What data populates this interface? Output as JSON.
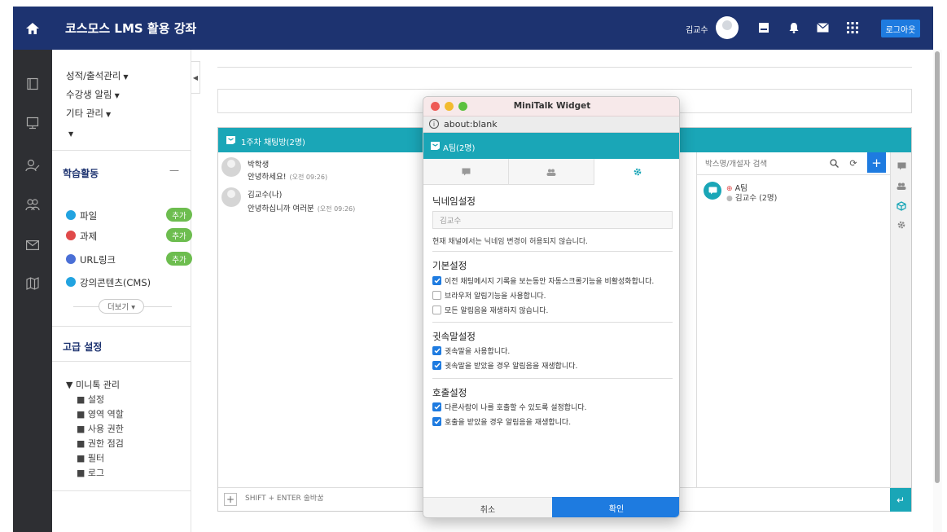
{
  "topbar": {
    "site_title": "코스모스 LMS 활용 강좌",
    "user_name": "김교수",
    "logout_label": "로그아웃"
  },
  "sidebar": {
    "menu_links": [
      {
        "label": "성적/출석관리"
      },
      {
        "label": "수강생 알림"
      },
      {
        "label": "기타 관리"
      }
    ],
    "activity_title": "학습활동",
    "collapse_symbol": "—",
    "activities": [
      {
        "label": "파일",
        "badge": "추가",
        "color": "#22a3e0"
      },
      {
        "label": "과제",
        "badge": "추가",
        "color": "#e04a4a"
      },
      {
        "label": "URL링크",
        "badge": "추가",
        "color": "#4a6fd6"
      },
      {
        "label": "강의콘텐츠(CMS)",
        "color": "#22a3e0"
      }
    ],
    "more_label": "더보기 ▾",
    "advanced_title": "고급 설정",
    "tree_root": "▼ 미니톡 관리",
    "tree_items": [
      "■ 설정",
      "■ 영역 역할",
      "■ 사용 권한",
      "■ 권한 점검",
      "■ 필터",
      "■ 로그"
    ]
  },
  "chat": {
    "title": "1주차 채팅방(2명)",
    "messages": [
      {
        "name": "박학생",
        "text": "안녕하세요!",
        "time": "(오전 09:26)"
      },
      {
        "name": "김교수(나)",
        "text": "안녕하십니까 여러분",
        "time": "(오전 09:26)"
      }
    ],
    "input_placeholder": "SHIFT + ENTER 줄바꿈",
    "search_placeholder": "박스명/개설자 검색",
    "room_name": "A팀",
    "room_owner": "김교수 (2명)"
  },
  "widget": {
    "window_title": "MiniTalk Widget",
    "url": "about:blank",
    "header_title": "A팀(2명)",
    "nickname_title": "닉네임설정",
    "nickname_value": "김교수",
    "nickname_note": "현재 채널에서는 닉네임 변경이 허용되지 않습니다.",
    "basic_title": "기본설정",
    "basic_options": [
      {
        "label": "이전 채팅메시지 기록을 보는동안 자동스크롤기능을 비활성화합니다.",
        "checked": true
      },
      {
        "label": "브라우저 알림기능을 사용합니다.",
        "checked": false
      },
      {
        "label": "모든 알림음을 재생하지 않습니다.",
        "checked": false
      }
    ],
    "whisper_title": "귓속말설정",
    "whisper_options": [
      {
        "label": "귓속말을 사용합니다.",
        "checked": true
      },
      {
        "label": "귓속말을 받았을 경우 알림음을 재생합니다.",
        "checked": true
      }
    ],
    "call_title": "호출설정",
    "call_options": [
      {
        "label": "다른사람이 나를 호출할 수 있도록 설정합니다.",
        "checked": true
      },
      {
        "label": "호출을 받았을 경우 알림음을 재생합니다.",
        "checked": true
      }
    ],
    "cancel_label": "취소",
    "ok_label": "확인"
  },
  "colors": {
    "navy": "#1d3370",
    "teal": "#1aa6b7",
    "blue": "#1e7be0",
    "green": "#6dbd4f"
  }
}
